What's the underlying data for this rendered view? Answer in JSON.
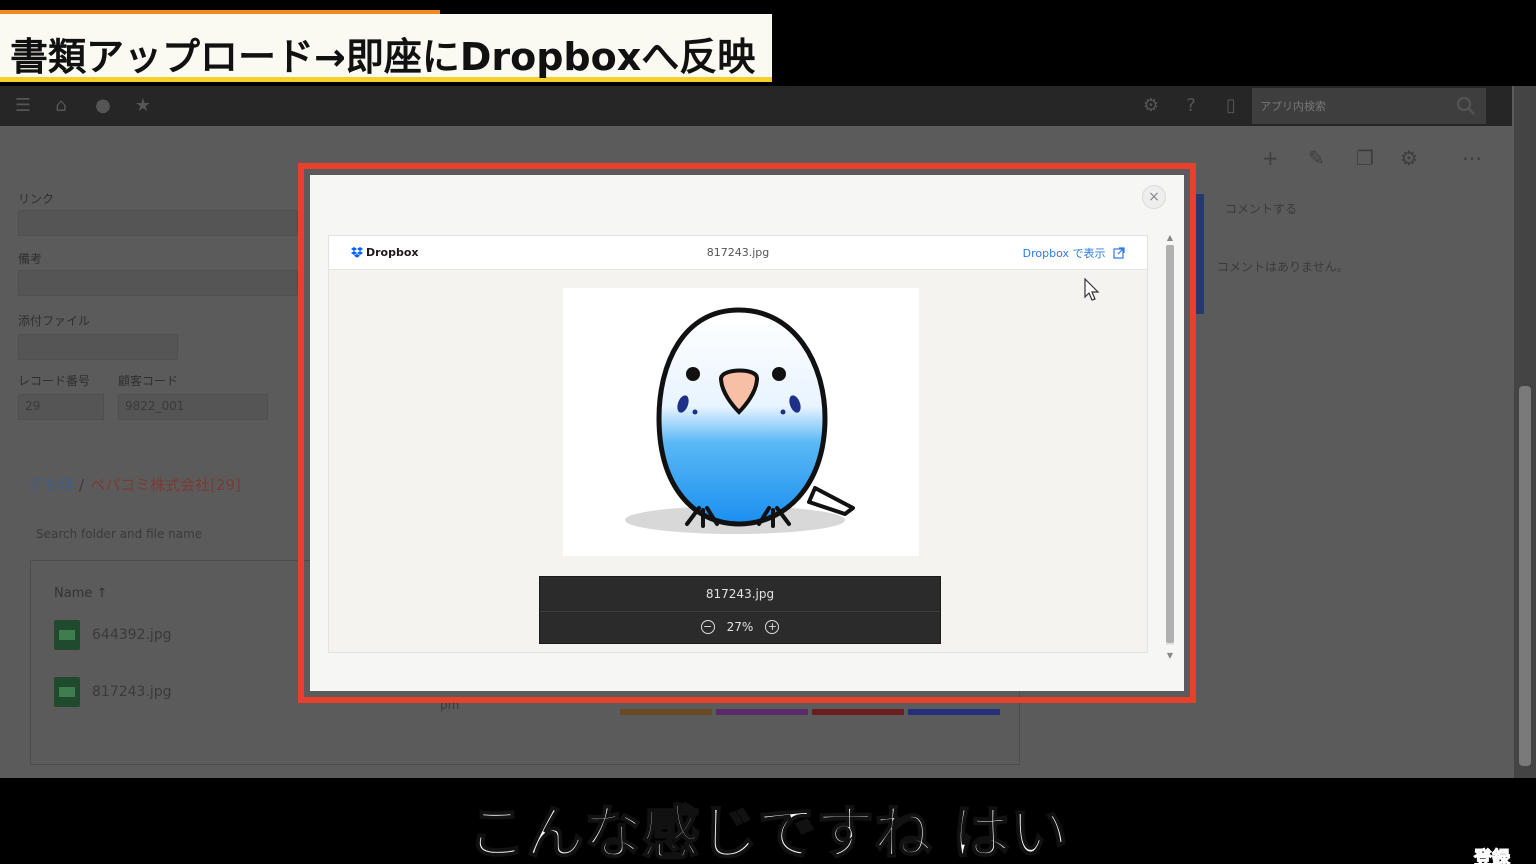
{
  "video": {
    "title_banner": "書類アップロード→即座にDropboxへ反映",
    "subtitle": "こんな感じですね はい",
    "subscribe_badge": "登録"
  },
  "app": {
    "header_search_placeholder": "アプリ内検索",
    "comment_link": "コメントする",
    "no_comments": "コメントはありません。",
    "form": {
      "label_link": "リンク",
      "label_note": "備考",
      "label_attachment": "添付ファイル",
      "label_record_no": "レコード番号",
      "label_customer_code": "顧客コード",
      "record_no_value": "29",
      "customer_code_value": "9822_001"
    },
    "folder": {
      "root": "デモ用",
      "separator": "/",
      "current": "ペパコミ株式会社[29]",
      "search_placeholder": "Search folder and file name",
      "column_name": "Name ↑",
      "files": [
        "644392.jpg",
        "817243.jpg"
      ]
    },
    "pm_label": "pm"
  },
  "modal": {
    "close_label": "×",
    "dropbox_brand": "Dropbox",
    "file_name": "817243.jpg",
    "open_in_dropbox": "Dropbox で表示",
    "viewer_file_name": "817243.jpg",
    "zoom_level": "27%",
    "zoom_out": "−",
    "zoom_in": "+"
  },
  "colors": {
    "highlight_border": "#e8402a",
    "dropbox_blue": "#0061fe",
    "link_blue": "#2d7ae5",
    "banner_yellow": "#f5cf2c",
    "banner_orange": "#f08a1c"
  }
}
